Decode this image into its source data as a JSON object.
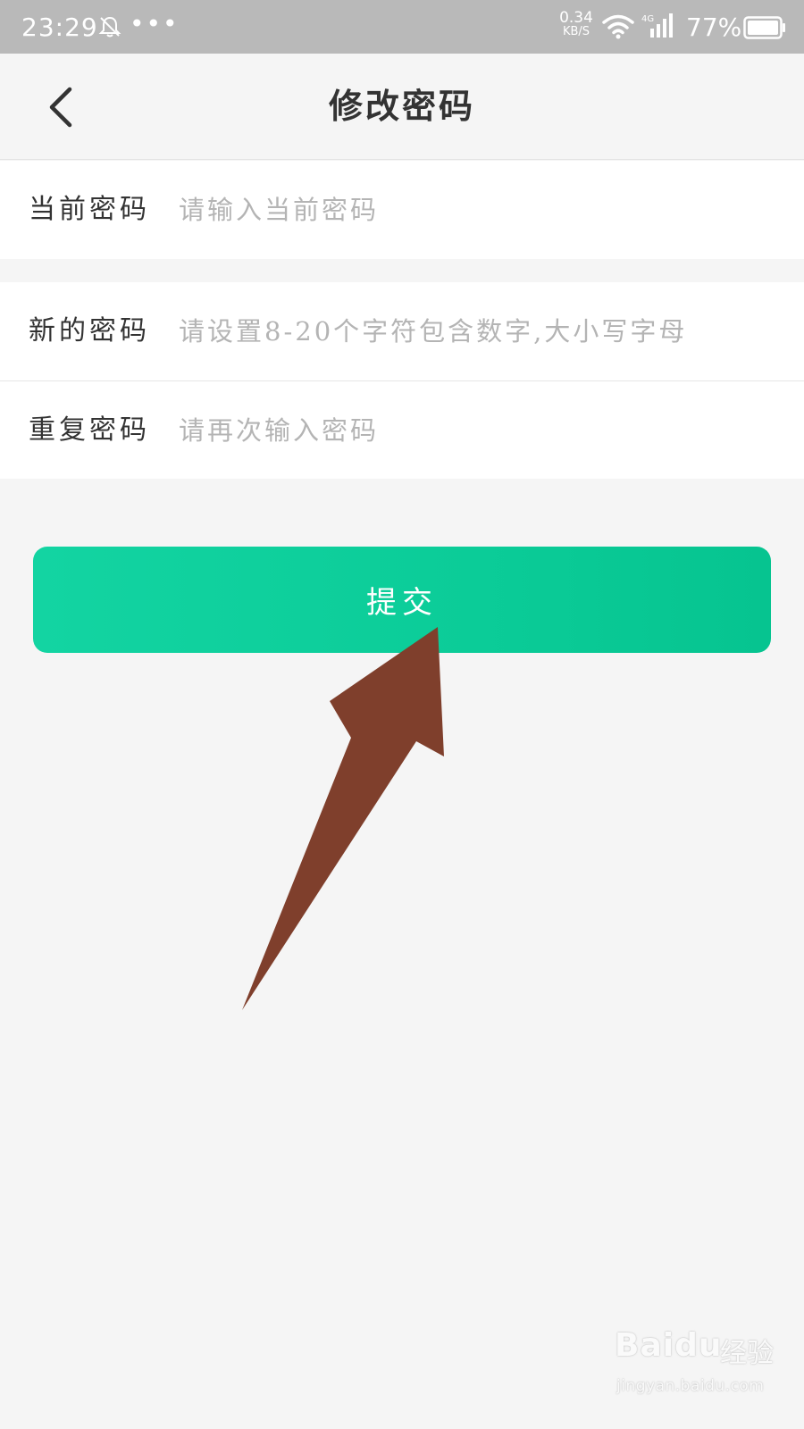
{
  "status_bar": {
    "time": "23:29",
    "more": "•••",
    "net_speed_value": "0.34",
    "net_speed_unit": "KB/S",
    "network_type": "4G",
    "battery_percent": "77%",
    "icons": [
      "bell-off-icon",
      "wifi-icon",
      "signal-icon",
      "battery-icon"
    ]
  },
  "nav": {
    "title": "修改密码",
    "back_icon": "chevron-left-icon"
  },
  "form": {
    "current_password": {
      "label": "当前密码",
      "placeholder": "请输入当前密码",
      "value": ""
    },
    "new_password": {
      "label": "新的密码",
      "placeholder": "请设置8-20个字符包含数字,大小写字母",
      "value": ""
    },
    "repeat_password": {
      "label": "重复密码",
      "placeholder": "请再次输入密码",
      "value": ""
    }
  },
  "submit": {
    "label": "提交"
  },
  "watermark": {
    "brand": "Baidu",
    "brand_cn": "经验",
    "url": "jingyan.baidu.com"
  },
  "colors": {
    "accent": "#0bcc98",
    "arrow": "#7f3f2c",
    "background": "#f5f5f5",
    "status_bar": "#b9b9b9"
  }
}
